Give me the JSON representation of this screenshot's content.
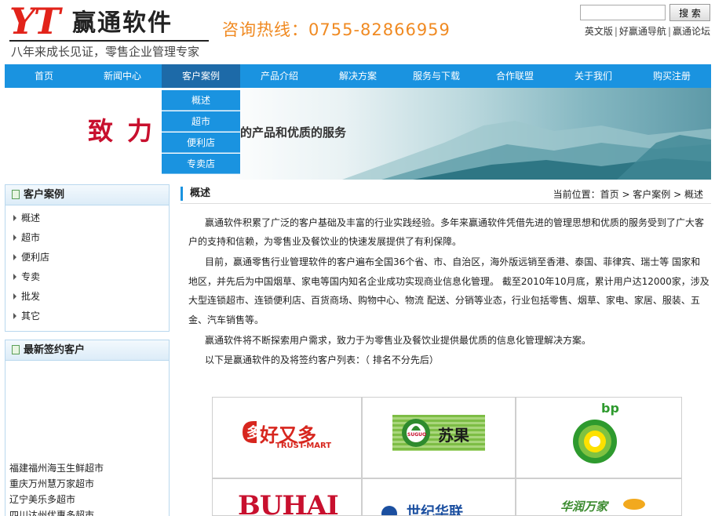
{
  "header": {
    "logo_mark": "YT",
    "logo_name": "赢通软件",
    "slogan": "八年来成长见证，零售企业管理专家",
    "hotline": "咨询热线：0755-82866959",
    "search_button": "搜 索",
    "search_placeholder": "",
    "links": [
      "英文版",
      "好赢通导航",
      "赢通论坛"
    ]
  },
  "nav": {
    "items": [
      "首页",
      "新闻中心",
      "客户案例",
      "产品介绍",
      "解决方案",
      "服务与下载",
      "合作联盟",
      "关于我们",
      "购买注册"
    ],
    "active_index": 2
  },
  "dropdown": {
    "items": [
      "概述",
      "超市",
      "便利店",
      "专卖店"
    ]
  },
  "banner": {
    "big": "致力",
    "text": "的产品和优质的服务"
  },
  "sidebar": {
    "cases_title": "客户案例",
    "cases": [
      "概述",
      "超市",
      "便利店",
      "专卖",
      "批发",
      "其它"
    ],
    "clients_title": "最新签约客户",
    "clients": [
      "福建福州海玉生鲜超市",
      "重庆万州慧万家超市",
      "辽宁美乐多超市",
      "四川达州优惠多超市"
    ]
  },
  "main": {
    "title": "概述",
    "breadcrumb": "当前位置：首页 > 客户案例 > 概述",
    "para1_l1": "赢通软件积累了广泛的客户基础及丰富的行业实践经验。多年来赢通软件凭借先进的管理思想和优质的服务受到了广大客",
    "para1_l2": "户的支持和信赖，为零售业及餐饮业的快速发展提供了有利保障。",
    "para2_l1": "目前，赢通零售行业管理软件的客户遍布全国36个省、市、自治区，海外版远销至香港、泰国、菲律宾、瑞士等 国家和",
    "para2_l2": "地区，并先后为中国烟草、家电等国内知名企业成功实现商业信息化管理。 截至2010年10月底，累计用户达12000家，涉及",
    "para2_l3": "大型连锁超市、连锁便利店、百货商场、购物中心、物流 配送、分销等业态，行业包括零售、烟草、家电、家居、服装、五",
    "para2_l4": "金、汽车销售等。",
    "para3": "赢通软件将不断探索用户需求，致力于为零售业及餐饮业提供最优质的信息化管理解决方案。",
    "para4": "以下是赢通软件的及将签约客户列表：（ 排名不分先后）"
  },
  "logos": {
    "trust_mart_cn": "好又多",
    "trust_mart_en": "TRUST-MART",
    "suguo_tag": "SUGUO",
    "suguo_cn": "苏果",
    "bp": "bp",
    "buhai": "BUHAI",
    "lianhua_cn": "世纪华联",
    "huarun": "华润万家"
  },
  "colors": {
    "nav_blue": "#1a93e0",
    "nav_active": "#1d6aa8",
    "hotline": "#f08a22",
    "brand_red": "#e2231a"
  }
}
